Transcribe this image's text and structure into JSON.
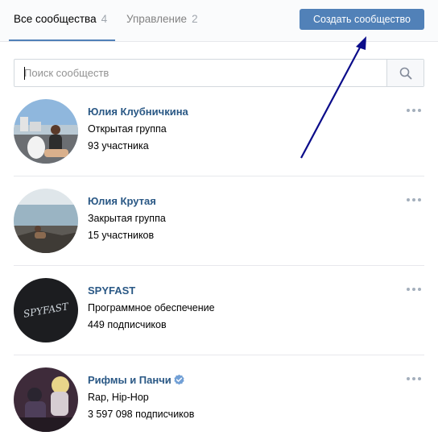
{
  "tabs": [
    {
      "label": "Все сообщества",
      "count": "4"
    },
    {
      "label": "Управление",
      "count": "2"
    }
  ],
  "create_button": {
    "label": "Создать сообщество"
  },
  "search": {
    "placeholder": "Поиск сообществ",
    "value": ""
  },
  "communities": [
    {
      "name": "Юлия Клубничкина",
      "type": "Открытая группа",
      "members": "93 участника"
    },
    {
      "name": "Юлия Крутая",
      "type": "Закрытая группа",
      "members": "15 участников"
    },
    {
      "name": "SPYFAST",
      "type": "Программное обеспечение",
      "members": "449 подписчиков",
      "avatar_text": "SPYFAST"
    },
    {
      "name": "Рифмы и Панчи",
      "type": "Rap, Hip-Hop",
      "members": "3 597 098 подписчиков",
      "verified": true
    }
  ],
  "colors": {
    "accent": "#5181b8",
    "link": "#2a5885",
    "annotation_arrow": "#00008b"
  },
  "icons": {
    "search": "search-icon",
    "more": "more-icon",
    "verified": "verified-icon"
  }
}
